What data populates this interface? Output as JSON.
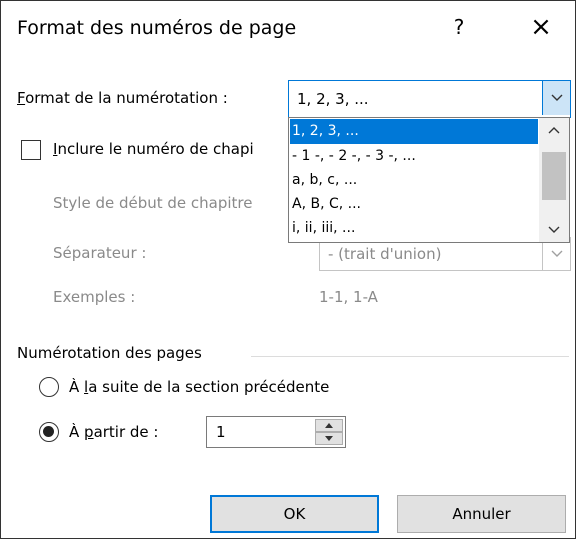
{
  "dialog": {
    "title": "Format des numéros de page",
    "help": "?",
    "close": "×"
  },
  "format": {
    "label_accel": "F",
    "label_rest": "ormat de la numérotation :",
    "value": "1, 2, 3, ...",
    "options": [
      "1, 2, 3, ...",
      "- 1 -, - 2 -, - 3 -, ...",
      "a, b, c, ...",
      "A, B, C, ...",
      "i, ii, iii, ..."
    ]
  },
  "chapter": {
    "include_accel": "I",
    "include_rest": "nclure le numéro de chapi",
    "style_label": "Style de début de chapitre",
    "separator_label": "Séparateur :",
    "separator_value": "-     (trait d'union)",
    "examples_label": "Exemples :",
    "examples_value": "1-1, 1-A"
  },
  "numbering": {
    "section_title": "Numérotation des pages",
    "continue_pre": "À ",
    "continue_accel": "l",
    "continue_rest": "a suite de la section précédente",
    "startat_pre": "À ",
    "startat_accel": "p",
    "startat_rest": "artir de :",
    "startat_value": "1"
  },
  "buttons": {
    "ok": "OK",
    "cancel": "Annuler"
  }
}
